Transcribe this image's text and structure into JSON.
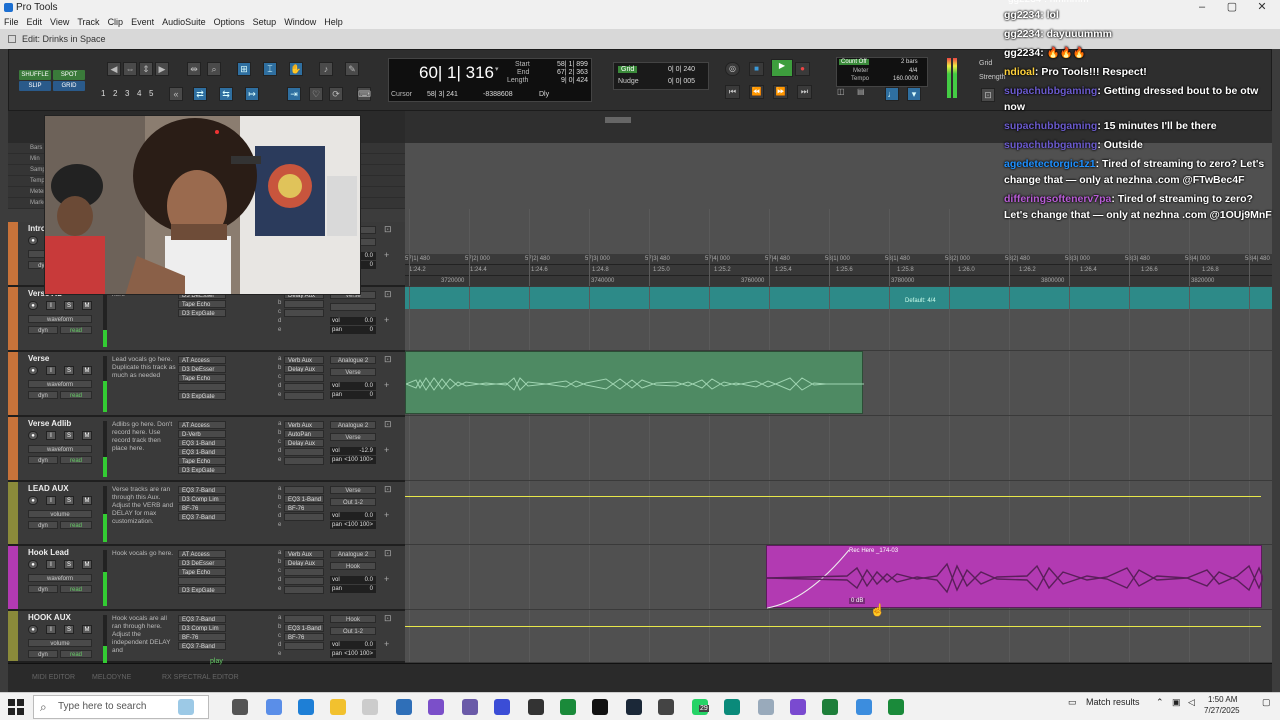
{
  "window": {
    "title": "Pro Tools",
    "edit_title": "Edit: Drinks in Space"
  },
  "menu": [
    "File",
    "Edit",
    "View",
    "Track",
    "Clip",
    "Event",
    "AudioSuite",
    "Options",
    "Setup",
    "Window",
    "Help"
  ],
  "toolbar": {
    "shuffle": "SHUFFLE",
    "spot": "SPOT",
    "slip": "SLIP",
    "grid": "GRID",
    "zoom_presets": [
      "1",
      "2",
      "3",
      "4",
      "5"
    ],
    "main_counter": "60| 1| 316",
    "start_label": "Start",
    "start_value": "58| 1| 899",
    "end_label": "End",
    "end_value": "67| 2| 363",
    "length_label": "Length",
    "length_value": "9| 0| 424",
    "cursor_label": "Cursor",
    "cursor_value": "58| 3| 241",
    "cursor_sample": "-8388608",
    "dly": "Dly",
    "grid_label": "Grid",
    "grid_value": "0| 0| 240",
    "nudge_label": "Nudge",
    "nudge_value": "0| 0| 005",
    "count_off": "Count Off",
    "meter_label": "Meter",
    "tempo_label": "Tempo",
    "count_bars": "2 bars",
    "meter_value": "4/4",
    "tempo_value": "160.0000",
    "grid_right": "Grid",
    "strength": "Strength"
  },
  "ruler": {
    "labels": [
      "Bars",
      "Min",
      "Samples",
      "Tempo",
      "Meter",
      "Markers"
    ],
    "bars": [
      "57|1| 480",
      "57|2| 000",
      "57|2| 480",
      "57|3| 000",
      "57|3| 480",
      "57|4| 000",
      "57|4| 480",
      "58|1| 000",
      "58|1| 480",
      "58|2| 000",
      "58|2| 480",
      "58|3| 000",
      "58|3| 480",
      "58|4| 000",
      "58|4| 480"
    ],
    "minsecs": [
      "1:24.2",
      "1:24.4",
      "1:24.6",
      "1:24.8",
      "1:25.0",
      "1:25.2",
      "1:25.4",
      "1:25.6",
      "1:25.8",
      "1:26.0",
      "1:26.2",
      "1:26.4",
      "1:26.6",
      "1:26.8"
    ],
    "samples": [
      "3720000",
      "3740000",
      "3760000",
      "3780000",
      "3800000",
      "3820000"
    ],
    "meter_marker": "Default: 4/4"
  },
  "tracks": [
    {
      "name": "Intro",
      "color": "#c8733a",
      "comment": "",
      "inserts": [],
      "sends": [],
      "io": [
        "",
        ""
      ],
      "vol": "0.0",
      "pan": "0",
      "mode": "waveform",
      "fill": 0.4
    },
    {
      "name": "Verse Ad",
      "color": "#c8733a",
      "comment": "here",
      "inserts": [
        "D3 DeEsser",
        "Tape Echo",
        "D3 ExpGate"
      ],
      "sends": [
        "Delay Aux",
        "",
        ""
      ],
      "io": [
        "Verse",
        ""
      ],
      "vol": "0.0",
      "pan": "0",
      "mode": "waveform",
      "fill": 0.3
    },
    {
      "name": "Verse",
      "color": "#c8733a",
      "comment": "Lead vocals go here. Duplicate this track as much as needed",
      "inserts": [
        "AT Access",
        "D3 DeEsser",
        "Tape Echo",
        "",
        "D3 ExpGate"
      ],
      "sends": [
        "Verb Aux",
        "Delay Aux",
        "",
        "",
        ""
      ],
      "io": [
        "Analogue 2",
        "Verse"
      ],
      "vol": "0.0",
      "pan": "0",
      "mode": "waveform",
      "fill": 0.55
    },
    {
      "name": "Verse Adlib",
      "color": "#c8733a",
      "comment": "Adlibs go here. Don't record here. Use record track then place here.",
      "inserts": [
        "AT Access",
        "D-Verb",
        "EQ3 1-Band",
        "EQ3 1-Band",
        "Tape Echo",
        "D3 ExpGate"
      ],
      "sends": [
        "Verb Aux",
        "AutoPan",
        "Delay Aux",
        "",
        ""
      ],
      "io": [
        "Analogue 2",
        "Verse"
      ],
      "vol": "-12.9",
      "pan": "<100 100>",
      "mode": "waveform",
      "fill": 0.35
    },
    {
      "name": "LEAD AUX",
      "color": "#8a8a3a",
      "comment": "Verse tracks are ran through this Aux. Adjust the VERB and DELAY for max customization.",
      "inserts": [
        "EQ3 7-Band",
        "D3 Comp Lim",
        "BF-76",
        "EQ3 7-Band"
      ],
      "sends": [
        "",
        "EQ3 1-Band",
        "BF-76",
        ""
      ],
      "io": [
        "Verse",
        "Out 1-2"
      ],
      "vol": "0.0",
      "pan": "<100 100>",
      "mode": "volume",
      "fill": 0.5
    },
    {
      "name": "Hook Lead",
      "color": "#b23ab2",
      "comment": "Hook vocals go here.",
      "inserts": [
        "AT Access",
        "D3 DeEsser",
        "Tape Echo",
        "",
        "D3 ExpGate"
      ],
      "sends": [
        "Verb Aux",
        "Delay Aux",
        "",
        "",
        ""
      ],
      "io": [
        "Analogue 2",
        "Hook"
      ],
      "vol": "0.0",
      "pan": "0",
      "mode": "waveform",
      "fill": 0.6
    },
    {
      "name": "HOOK AUX",
      "color": "#8a8a3a",
      "comment": "Hook vocals are all ran through here. Adjust the independent DELAY and",
      "inserts": [
        "EQ3 7-Band",
        "D3 Comp Lim",
        "BF-76",
        "EQ3 7-Band"
      ],
      "sends": [
        "",
        "EQ3 1-Band",
        "BF-76",
        ""
      ],
      "io": [
        "Hook",
        "Out 1-2"
      ],
      "vol": "0.0",
      "pan": "<100 100>",
      "mode": "volume",
      "fill": 0.45
    }
  ],
  "track_labels": {
    "s": "S",
    "m": "M",
    "i": "I",
    "vol": "vol",
    "pan": "pan",
    "dyn": "dyn",
    "read": "read",
    "play": "play"
  },
  "clips": {
    "magenta_name": "Rec Here _174-03",
    "magenta_gain": "0 dB"
  },
  "chat": [
    {
      "user": "gg2234",
      "msg": ": lol",
      "color": "#ffffff"
    },
    {
      "user": "gg2234",
      "msg": ": dayuuummm",
      "color": "#ffffff"
    },
    {
      "user": "gg2234",
      "msg": ": 🔥🔥🔥",
      "color": "#ffffff"
    },
    {
      "user": "ndioal",
      "msg": ": Pro Tools!!! Respect!",
      "color": "#ffd23c"
    },
    {
      "user": "supachubbgaming",
      "msg": ": Getting dressed bout to be otw",
      "msg2": "now",
      "color": "#6a5acd"
    },
    {
      "user": "supachubbgaming",
      "msg": ": 15 minutes I'll be there",
      "color": "#6a5acd"
    },
    {
      "user": "supachubbgaming",
      "msg": ": Outside",
      "color": "#6a5acd"
    },
    {
      "user": "agedetectorgic1z1",
      "msg": ": Tired of streaming to zero? Let's",
      "msg2": "change that — only at nezhna .com @FTwBec4F",
      "color": "#1e90ff"
    },
    {
      "user": "differingsoftenerv7pa",
      "msg": ": Tired of streaming to zero?",
      "msg2": "Let's change that — only at nezhna .com @1OUj9MnF",
      "color": "#b85cd6"
    }
  ],
  "bottom": [
    "MIDI EDITOR",
    "MELODYNE",
    "RX SPECTRAL EDITOR"
  ],
  "taskbar": {
    "search_placeholder": "Type here to search",
    "match_results": "Match results",
    "time": "1:50 AM",
    "date": "7/27/2025",
    "badge": "29"
  }
}
